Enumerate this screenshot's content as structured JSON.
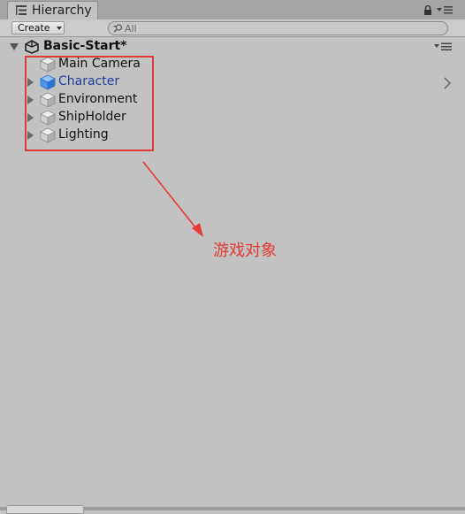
{
  "window": {
    "tab_title": "Hierarchy"
  },
  "toolbar": {
    "create_label": "Create",
    "search_placeholder": "All"
  },
  "scene": {
    "name": "Basic-Start*"
  },
  "objects": [
    {
      "label": "Main Camera",
      "has_children": false,
      "selected_blue": false
    },
    {
      "label": "Character",
      "has_children": true,
      "selected_blue": true
    },
    {
      "label": "Environment",
      "has_children": true,
      "selected_blue": false
    },
    {
      "label": "ShipHolder",
      "has_children": true,
      "selected_blue": false
    },
    {
      "label": "Lighting",
      "has_children": true,
      "selected_blue": false
    }
  ],
  "annotation": {
    "text": "游戏对象",
    "color": "#e53935"
  },
  "colors": {
    "panel_bg": "#c2c2c2",
    "highlight_red": "#e03b3b",
    "prefab_blue": "#1f3f9a"
  }
}
